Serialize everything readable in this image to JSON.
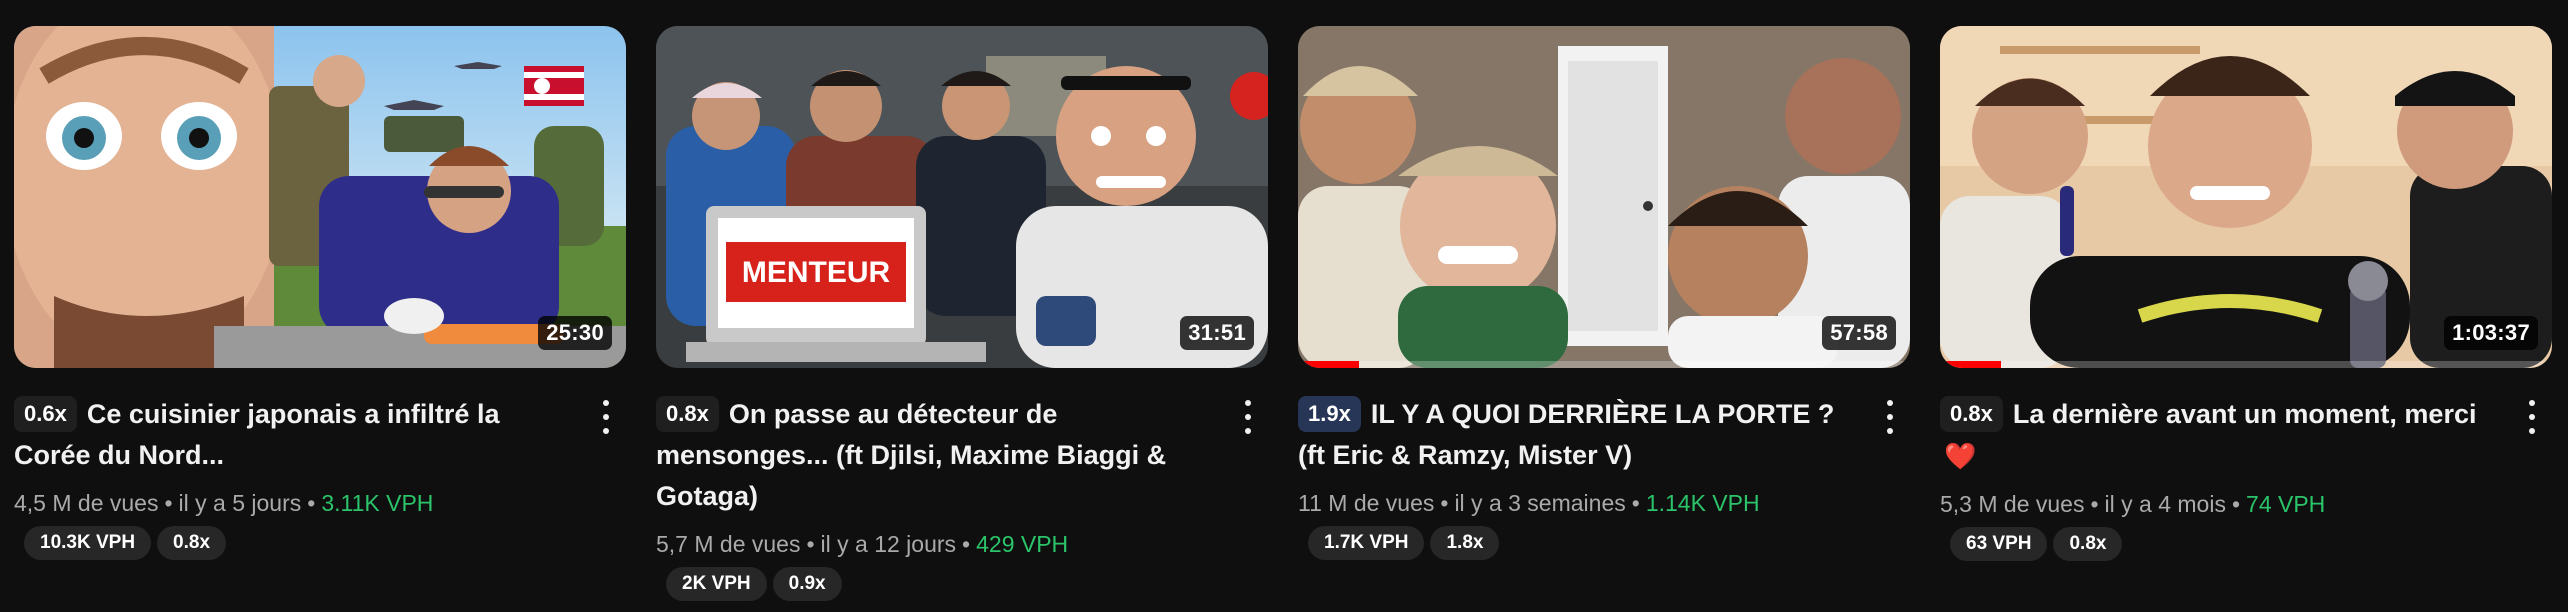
{
  "colors": {
    "background": "#0f0f0f",
    "vph_green": "#2bc46a",
    "progress_red": "#ff0000",
    "speed_chip_blue": "#273657"
  },
  "videos": [
    {
      "speed": "0.6x",
      "title": "Ce cuisinier japonais a infiltré la Corée du Nord...",
      "duration": "25:30",
      "views": "4,5 M de vues",
      "age": "il y a 5 jours",
      "vph": "3.11K VPH",
      "chips": [
        "10.3K VPH",
        "0.8x"
      ],
      "progress": 0
    },
    {
      "speed": "0.8x",
      "title": "On passe au détecteur de mensonges... (ft Djilsi, Maxime Biaggi & Gotaga)",
      "duration": "31:51",
      "views": "5,7 M de vues",
      "age": "il y a 12 jours",
      "vph": "429 VPH",
      "chips": [
        "2K VPH",
        "0.9x"
      ],
      "progress": 0
    },
    {
      "speed": "1.9x",
      "title": "IL Y A QUOI DERRIÈRE LA PORTE ? (ft Eric & Ramzy, Mister V)",
      "duration": "57:58",
      "views": "11 M de vues",
      "age": "il y a 3 semaines",
      "vph": "1.14K VPH",
      "chips": [
        "1.7K VPH",
        "1.8x"
      ],
      "progress": 0.1
    },
    {
      "speed": "0.8x",
      "title": "La dernière avant un moment, merci",
      "title_emoji": "❤️",
      "duration": "1:03:37",
      "views": "5,3 M de vues",
      "age": "il y a 4 mois",
      "vph": "74 VPH",
      "chips": [
        "63 VPH",
        "0.8x"
      ],
      "progress": 0.1
    }
  ]
}
